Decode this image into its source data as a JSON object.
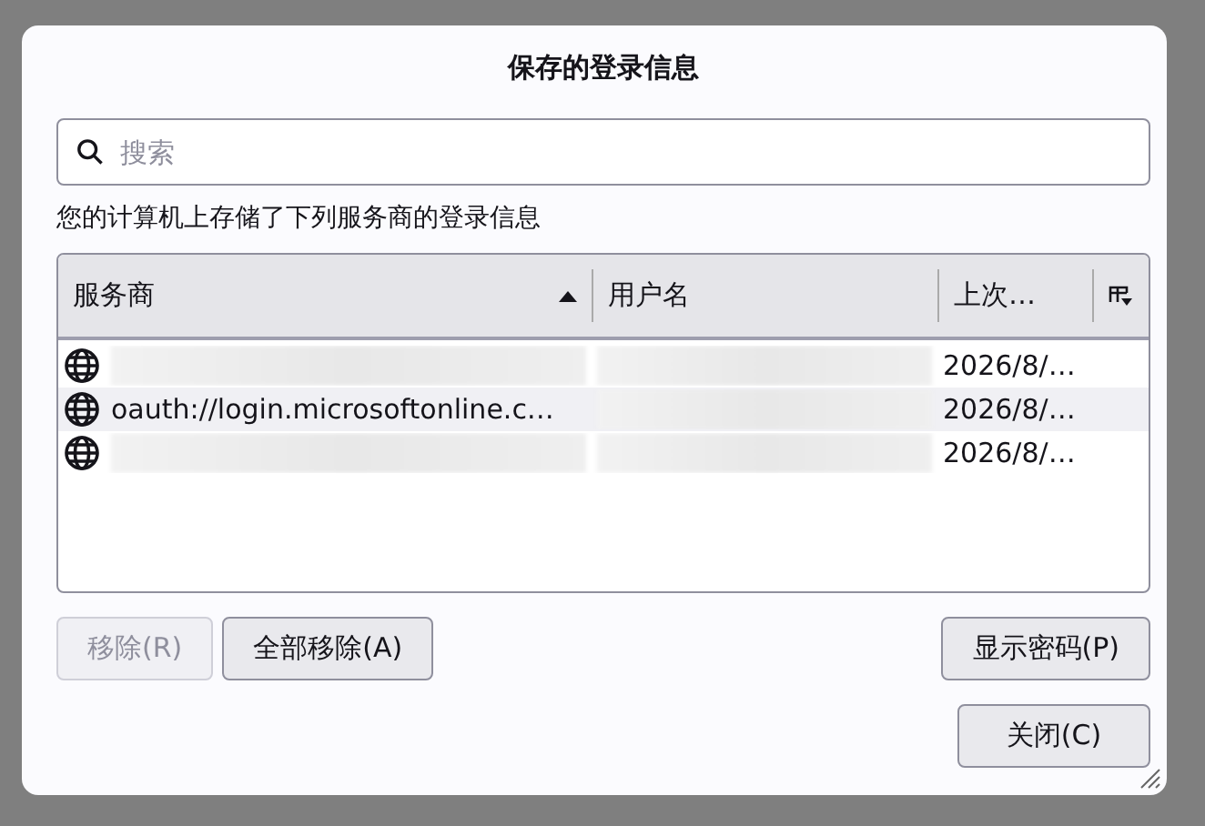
{
  "dialog": {
    "title": "保存的登录信息",
    "search": {
      "placeholder": "搜索"
    },
    "description": "您的计算机上存储了下列服务商的登录信息",
    "table": {
      "columns": [
        {
          "label": "服务商",
          "sorted": true
        },
        {
          "label": "用户名",
          "sorted": false
        },
        {
          "label": "上次…",
          "sorted": false
        }
      ],
      "rows": [
        {
          "selected": false,
          "provider": {
            "kind": "redacted"
          },
          "username": {
            "kind": "redacted"
          },
          "date": "2026/8/…"
        },
        {
          "selected": true,
          "provider": {
            "kind": "text",
            "text": "oauth://login.microsoftonline.c…"
          },
          "username": {
            "kind": "redacted"
          },
          "date": "2026/8/…"
        },
        {
          "selected": false,
          "provider": {
            "kind": "redacted"
          },
          "username": {
            "kind": "redacted"
          },
          "date": "2026/8/…"
        }
      ]
    },
    "buttons": [
      {
        "label": "移除(R)",
        "disabled": true
      },
      {
        "label": "全部移除(A)",
        "disabled": false
      }
    ],
    "show_passwords": {
      "label": "显示密码(P)"
    },
    "close": {
      "label": "关闭(C)"
    }
  }
}
